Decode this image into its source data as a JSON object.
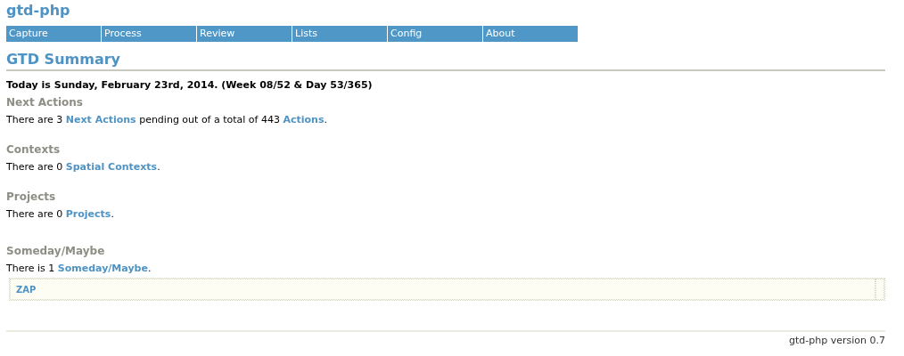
{
  "site_title": "gtd-php",
  "nav": [
    {
      "label": "Capture"
    },
    {
      "label": "Process"
    },
    {
      "label": "Review"
    },
    {
      "label": "Lists"
    },
    {
      "label": "Config"
    },
    {
      "label": "About"
    }
  ],
  "page_title": "GTD Summary",
  "today": "Today is Sunday, February 23rd, 2014. (Week 08/52 & Day 53/365)",
  "sections": [
    {
      "heading": "Next Actions",
      "sentence": [
        {
          "kind": "text",
          "text": "There are 3 "
        },
        {
          "kind": "link",
          "text": "Next Actions"
        },
        {
          "kind": "text",
          "text": " pending out of a total of 443 "
        },
        {
          "kind": "link",
          "text": "Actions"
        },
        {
          "kind": "text",
          "text": "."
        }
      ]
    },
    {
      "heading": "Contexts",
      "sentence": [
        {
          "kind": "text",
          "text": "There are 0 "
        },
        {
          "kind": "link",
          "text": "Spatial Contexts"
        },
        {
          "kind": "text",
          "text": "."
        }
      ]
    },
    {
      "heading": "Projects",
      "sentence": [
        {
          "kind": "text",
          "text": "There are 0 "
        },
        {
          "kind": "link",
          "text": "Projects"
        },
        {
          "kind": "text",
          "text": "."
        }
      ]
    },
    {
      "heading": "Someday/Maybe",
      "sentence": [
        {
          "kind": "text",
          "text": "There is 1 "
        },
        {
          "kind": "link",
          "text": "Someday/Maybe"
        },
        {
          "kind": "text",
          "text": "."
        }
      ],
      "items": [
        "ZAP"
      ]
    }
  ],
  "footer": "gtd-php version 0.7"
}
